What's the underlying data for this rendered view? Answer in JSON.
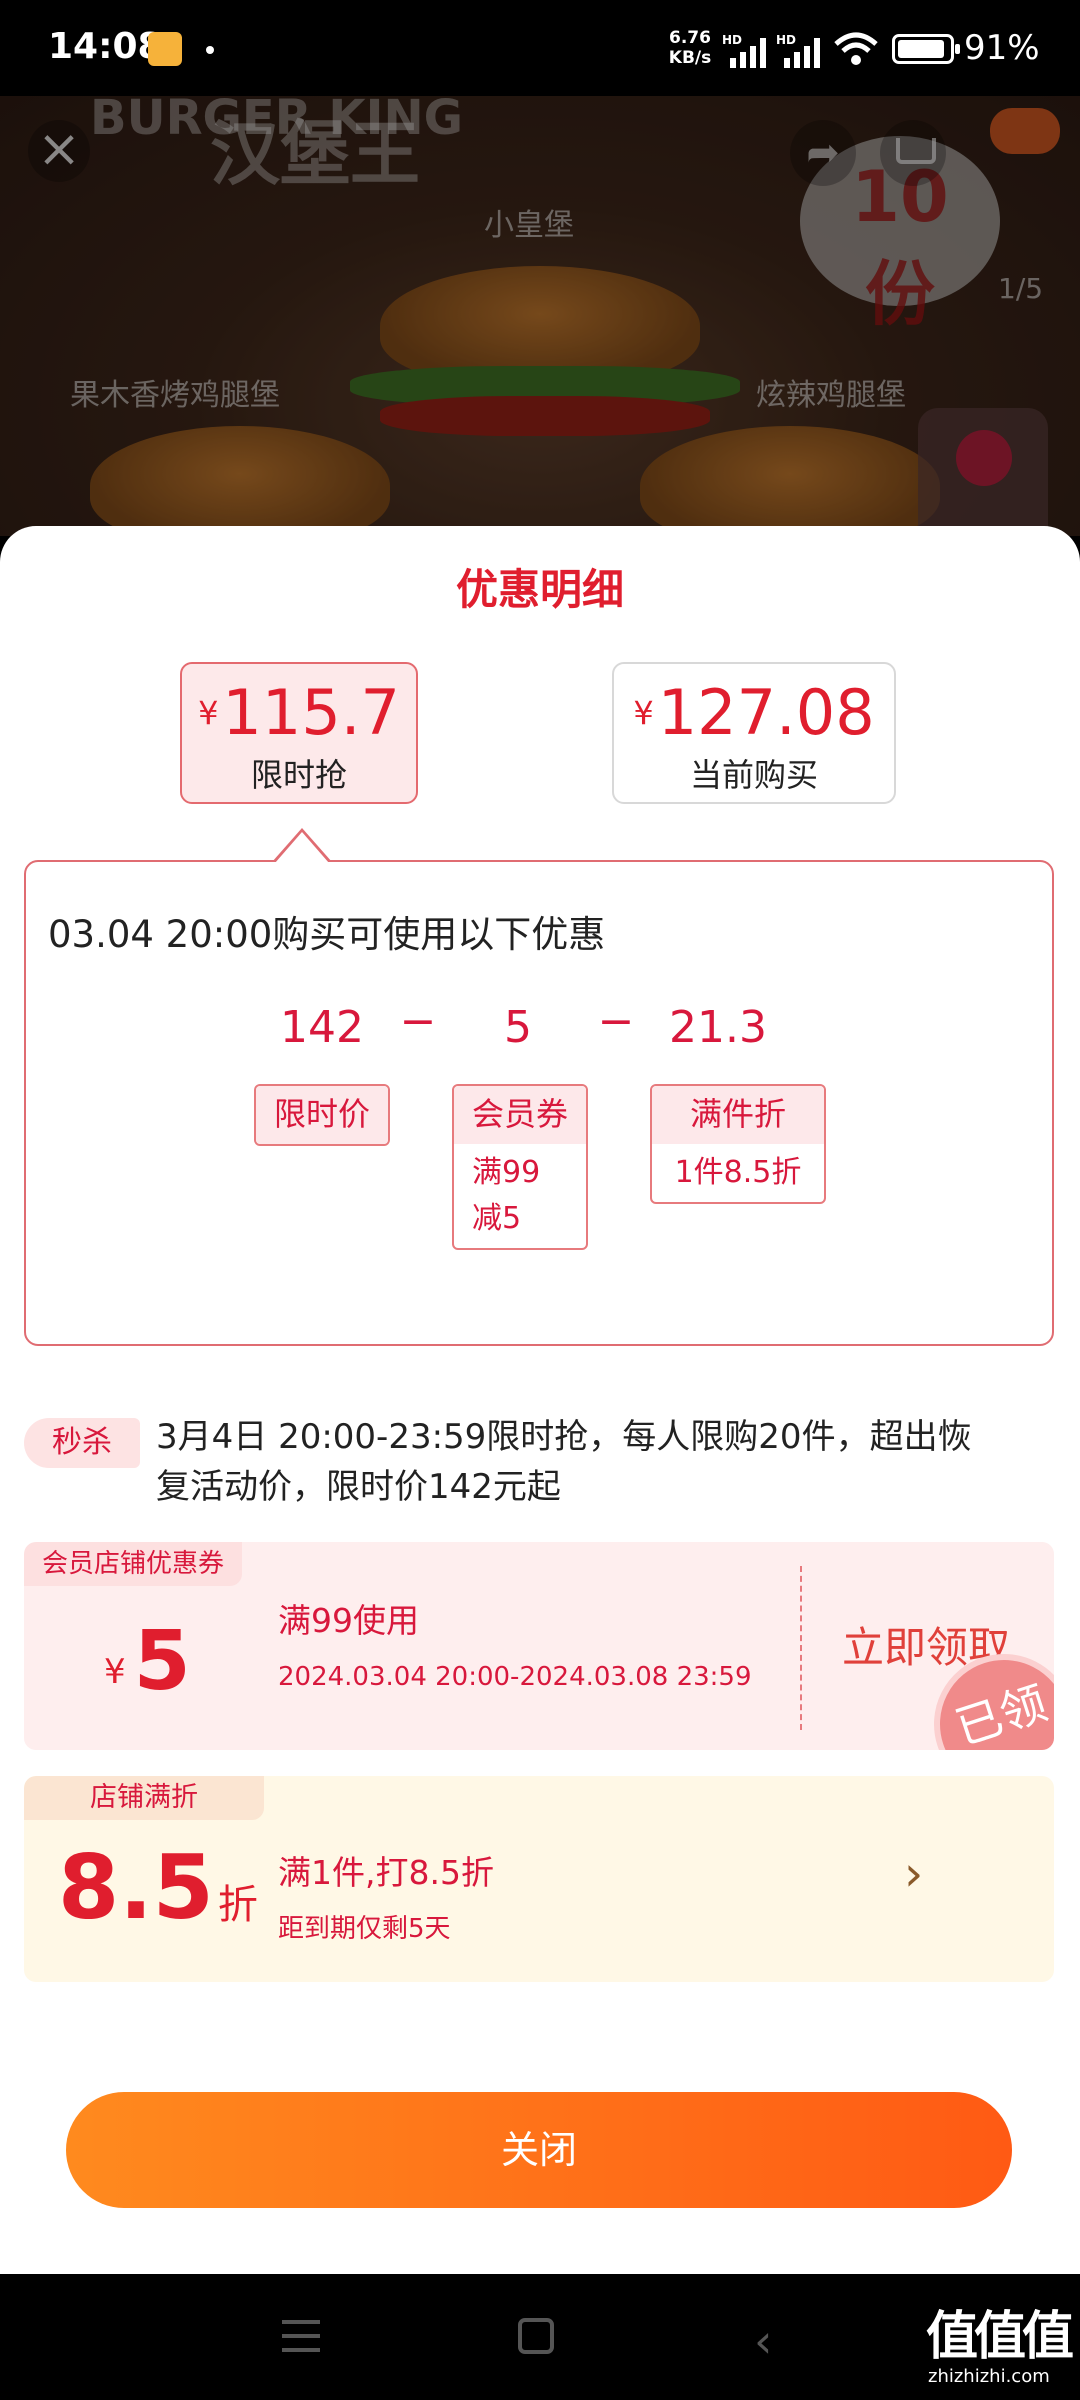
{
  "status_bar": {
    "time": "14:08",
    "net_speed_top": "6.76",
    "net_speed_bottom": "KB/s",
    "battery": "91%"
  },
  "hero": {
    "brand_en": "BURGER KING",
    "brand_cn": "汉堡王",
    "label_center": "小皇堡",
    "label_left": "果木香烤鸡腿堡",
    "label_right": "炫辣鸡腿堡",
    "splash_text": "10份",
    "page_indicator": "1/5",
    "close_icon": "close-icon",
    "share_icon": "share-icon",
    "cart_icon": "cart-icon"
  },
  "sheet": {
    "title": "优惠明细",
    "prices": [
      {
        "currency": "¥",
        "amount": "115.7",
        "label": "限时抢"
      },
      {
        "currency": "¥",
        "amount": "127.08",
        "label": "当前购买"
      }
    ],
    "detail": {
      "heading": "03.04 20:00购买可使用以下优惠",
      "calc": {
        "values": [
          "142",
          "5",
          "21.3"
        ],
        "operators": [
          "−",
          "−"
        ]
      },
      "tags": [
        {
          "label": "限时价",
          "body": ""
        },
        {
          "label": "会员券",
          "body_line1": "满99",
          "body_line2": "减5"
        },
        {
          "label": "满件折",
          "body": "1件8.5折"
        }
      ]
    },
    "seckill": {
      "badge": "秒杀",
      "text": "3月4日 20:00-23:59限时抢，每人限购20件，超出恢复活动价，限时价142元起"
    },
    "coupon": {
      "tag": "会员店铺优惠券",
      "currency": "¥",
      "amount": "5",
      "condition": "满99使用",
      "period": "2024.03.04 20:00-2024.03.08 23:59",
      "claim": "立即领取",
      "stamp": "已领"
    },
    "discount": {
      "tag": "店铺满折",
      "value": "8.5",
      "unit": "折",
      "condition": "满1件,打8.5折",
      "expiry": "距到期仅剩5天"
    },
    "close_button": "关闭"
  },
  "watermark": {
    "main": "值值值",
    "sub": "zhizhizhi.com"
  },
  "colors": {
    "accent_red": "#e01e2e",
    "button_orange": "#ff6a18",
    "coupon_bg": "#feeeee",
    "discount_bg": "#fff8e6"
  }
}
